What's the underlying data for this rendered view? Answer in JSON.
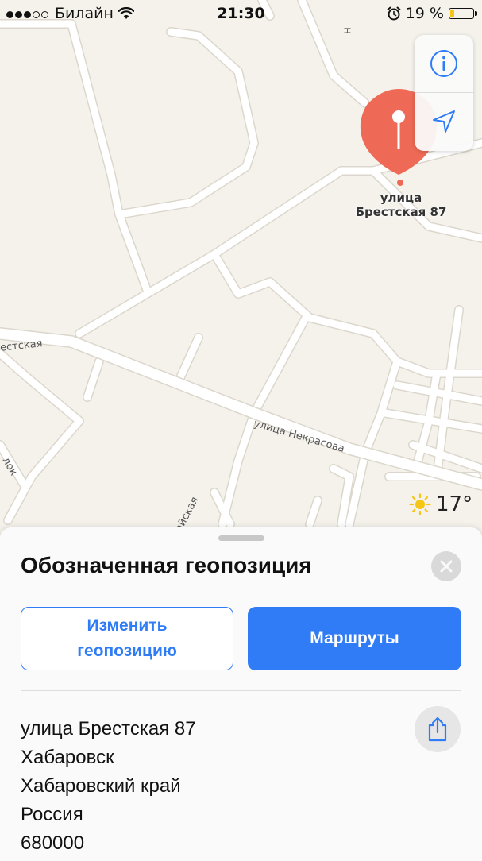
{
  "status_bar": {
    "carrier": "Билайн",
    "time": "21:30",
    "battery": "19 %",
    "battery_level": 0.19,
    "signal_bars": 3,
    "signal_total": 5
  },
  "map": {
    "pin_label_line1": "улица",
    "pin_label_line2": "Брестская 87",
    "road_labels": {
      "nekrasova": "улица Некрасова",
      "brestskaya_partial": "естская",
      "ayskaya_partial": "айская",
      "pereulok_partial": "лок",
      "top_partial": "Н"
    },
    "weather": {
      "temp": "17°",
      "icon": "sun-icon"
    },
    "controls": {
      "info_icon": "info-icon",
      "location_icon": "location-arrow-icon"
    },
    "colors": {
      "land": "#f5f2ec",
      "road": "#ffffff",
      "road_edge": "#dcd7cc",
      "pin": "#ee6a56"
    }
  },
  "sheet": {
    "title": "Обозначенная геопозиция",
    "edit_button": "Изменить геопозицию",
    "routes_button": "Маршруты",
    "address_lines": [
      "улица Брестская 87",
      "Хабаровск",
      "Хабаровский край",
      "Россия",
      "680000"
    ],
    "colors": {
      "accent": "#2f7cf6"
    }
  }
}
